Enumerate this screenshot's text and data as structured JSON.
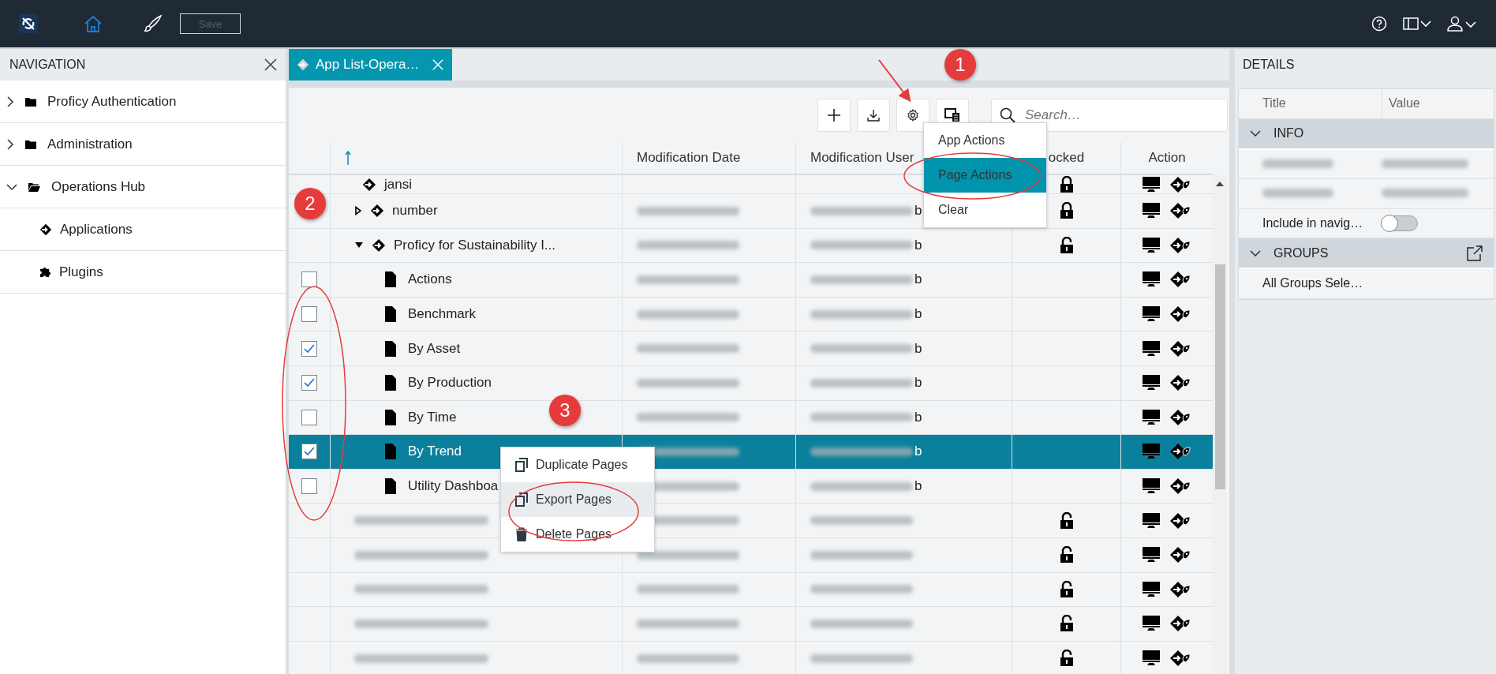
{
  "topbar": {
    "save": {
      "label": "Save",
      "disabled": true
    }
  },
  "navigation": {
    "title": "NAVIGATION",
    "items": [
      {
        "label": "Proficy Authentication",
        "kind": "folder",
        "expanded": false
      },
      {
        "label": "Administration",
        "kind": "folder",
        "expanded": false
      },
      {
        "label": "Operations Hub",
        "kind": "folder",
        "expanded": true,
        "children": [
          {
            "label": "Applications",
            "kind": "app"
          },
          {
            "label": "Plugins",
            "kind": "plugin"
          }
        ]
      }
    ]
  },
  "tabs": [
    {
      "label": "App List-Opera…",
      "selected": true
    }
  ],
  "toolbar": {
    "search": {
      "placeholder": "Search…"
    }
  },
  "table": {
    "columns": [
      {
        "label": "Modification Date"
      },
      {
        "label": "Modification User"
      },
      {
        "label": "ocked"
      },
      {
        "label": "Action"
      }
    ],
    "rows": [
      {
        "kind": "clipped",
        "name": "jansi",
        "locked": true,
        "selected": false
      },
      {
        "kind": "app",
        "name": "number",
        "expanded": false,
        "user": "b",
        "locked": true,
        "selected": false
      },
      {
        "kind": "app",
        "name": "Proficy for Sustainability I...",
        "expanded": true,
        "user": "b",
        "locked": false,
        "selected": false
      },
      {
        "kind": "page",
        "name": "Actions",
        "checked": false,
        "user": "b",
        "selected": false
      },
      {
        "kind": "page",
        "name": "Benchmark",
        "checked": false,
        "user": "b",
        "selected": false
      },
      {
        "kind": "page",
        "name": "By Asset",
        "checked": true,
        "user": "b",
        "selected": false
      },
      {
        "kind": "page",
        "name": "By Production",
        "checked": true,
        "user": "b",
        "selected": false
      },
      {
        "kind": "page",
        "name": "By Time",
        "checked": false,
        "user": "b",
        "selected": false
      },
      {
        "kind": "page",
        "name": "By Trend",
        "checked": true,
        "user": "b",
        "selected": true
      },
      {
        "kind": "page",
        "name": "Utility Dashboa",
        "checked": false,
        "user": "b",
        "selected": false
      },
      {
        "kind": "blurred",
        "locked": false,
        "selected": false
      },
      {
        "kind": "blurred",
        "locked": false,
        "selected": false
      },
      {
        "kind": "blurred",
        "locked": false,
        "selected": false
      },
      {
        "kind": "blurred",
        "locked": false,
        "selected": false
      },
      {
        "kind": "blurred",
        "locked": false,
        "selected": false
      }
    ]
  },
  "details": {
    "title": "DETAILS",
    "columns": [
      "Title",
      "Value"
    ],
    "groups": [
      {
        "label": "INFO",
        "expanded": true,
        "rows": [
          {
            "kind": "blurred"
          },
          {
            "kind": "blurred"
          },
          {
            "kind": "toggle",
            "label": "Include in navig…",
            "on": false
          }
        ]
      },
      {
        "label": "GROUPS",
        "expanded": true,
        "rows": [
          {
            "kind": "text",
            "label": "All Groups Sele…"
          }
        ]
      }
    ]
  },
  "gear_menu": {
    "items": [
      {
        "label": "App Actions",
        "selected": false
      },
      {
        "label": "Page Actions",
        "selected": true
      },
      {
        "label": "Clear",
        "selected": false
      }
    ]
  },
  "context_menu": {
    "items": [
      {
        "label": "Duplicate Pages",
        "kind": "copy",
        "hovered": false
      },
      {
        "label": "Export Pages",
        "kind": "copy",
        "hovered": true
      },
      {
        "label": "Delete Pages",
        "kind": "trash",
        "hovered": false
      }
    ]
  },
  "callouts": [
    {
      "label": "1"
    },
    {
      "label": "2"
    },
    {
      "label": "3"
    }
  ]
}
